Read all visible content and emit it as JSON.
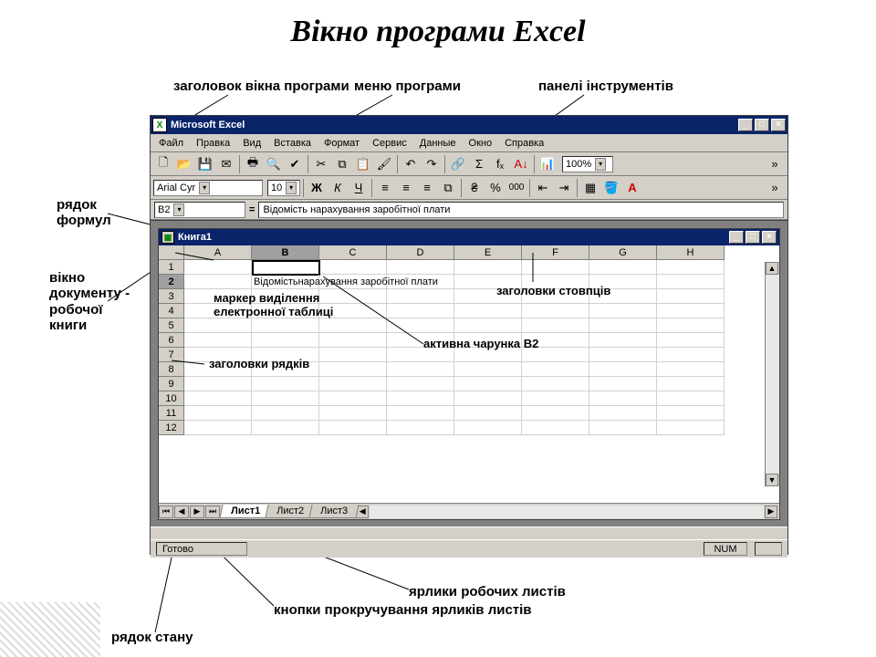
{
  "page_title": "Вікно програми Excel",
  "callouts": {
    "title_bar": "заголовок вікна програми",
    "menu": "меню програми",
    "toolbars": "панелі інструментів",
    "formula_row": "рядок\nформул",
    "workbook_window": "вікно\nдокументу -\nробочої\nкниги",
    "col_headers": "заголовки стовпців",
    "selection_marker": "маркер виділення\nелектронної таблиці",
    "active_cell": "активна чарунка B2",
    "row_headers": "заголовки рядків",
    "sheet_tabs": "ярлики робочих листів",
    "tab_scroll": "кнопки прокручування ярликів листів",
    "status_row": "рядок стану"
  },
  "window": {
    "app_title": "Microsoft Excel",
    "menu": [
      "Файл",
      "Правка",
      "Вид",
      "Вставка",
      "Формат",
      "Сервис",
      "Данные",
      "Окно",
      "Справка"
    ],
    "font_name": "Arial Cyr",
    "font_size": "10",
    "zoom": "100%",
    "namebox": "B2",
    "formula": "Відомість нарахування заробітної плати",
    "book_title": "Книга1",
    "columns": [
      "A",
      "B",
      "C",
      "D",
      "E",
      "F",
      "G",
      "H"
    ],
    "rows": [
      "1",
      "2",
      "3",
      "4",
      "5",
      "6",
      "7",
      "8",
      "9",
      "10",
      "11",
      "12"
    ],
    "active_col": "B",
    "active_row": "2",
    "cell_b2_display_short": "Відомість",
    "cell_b2_overflow": "нарахування заробітної плати",
    "sheets": [
      "Лист1",
      "Лист2",
      "Лист3"
    ],
    "status_ready": "Готово",
    "status_num": "NUM"
  },
  "fmt_bold": "Ж",
  "fmt_italic": "К",
  "fmt_underline": "Ч",
  "percent": "%",
  "thousand": "000",
  "sigma": "Σ",
  "fx": "fₓ"
}
